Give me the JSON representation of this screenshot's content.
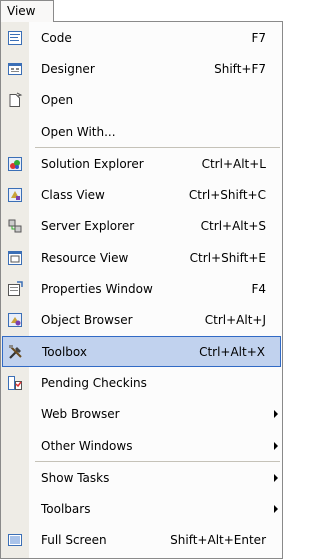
{
  "menu_title": "View",
  "items": [
    {
      "label": "Code",
      "shortcut": "F7",
      "icon": "code-icon"
    },
    {
      "label": "Designer",
      "shortcut": "Shift+F7",
      "icon": "designer-icon"
    },
    {
      "label": "Open",
      "shortcut": "",
      "icon": "open-icon"
    },
    {
      "label": "Open With...",
      "shortcut": "",
      "icon": ""
    },
    {
      "label": "Solution Explorer",
      "shortcut": "Ctrl+Alt+L",
      "icon": "solution-explorer-icon"
    },
    {
      "label": "Class View",
      "shortcut": "Ctrl+Shift+C",
      "icon": "class-view-icon"
    },
    {
      "label": "Server Explorer",
      "shortcut": "Ctrl+Alt+S",
      "icon": "server-explorer-icon"
    },
    {
      "label": "Resource View",
      "shortcut": "Ctrl+Shift+E",
      "icon": "resource-view-icon"
    },
    {
      "label": "Properties Window",
      "shortcut": "F4",
      "icon": "properties-window-icon"
    },
    {
      "label": "Object Browser",
      "shortcut": "Ctrl+Alt+J",
      "icon": "object-browser-icon"
    },
    {
      "label": "Toolbox",
      "shortcut": "Ctrl+Alt+X",
      "icon": "toolbox-icon",
      "selected": true
    },
    {
      "label": "Pending Checkins",
      "shortcut": "",
      "icon": "pending-checkins-icon"
    },
    {
      "label": "Web Browser",
      "shortcut": "",
      "icon": "",
      "submenu": true
    },
    {
      "label": "Other Windows",
      "shortcut": "",
      "icon": "",
      "submenu": true
    },
    {
      "label": "Show Tasks",
      "shortcut": "",
      "icon": "",
      "submenu": true
    },
    {
      "label": "Toolbars",
      "shortcut": "",
      "icon": "",
      "submenu": true
    },
    {
      "label": "Full Screen",
      "shortcut": "Shift+Alt+Enter",
      "icon": "full-screen-icon"
    }
  ]
}
